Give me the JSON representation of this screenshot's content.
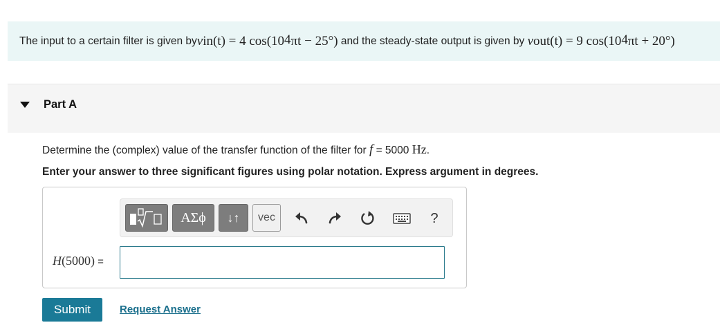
{
  "intro": {
    "text_before": "The input to a certain filter is given by ",
    "vin_symbol": "v",
    "vin_sub": "in",
    "vin_expr_a": "(t) = 4 cos(10",
    "vin_exp": "4",
    "vin_expr_b": "πt − 25°)",
    "text_middle": " and the steady-state output is given by ",
    "vout_symbol": "v",
    "vout_sub": "out",
    "vout_expr_a": "(t) = 9 cos(10",
    "vout_exp": "4",
    "vout_expr_b": "πt + 20°)"
  },
  "part": {
    "title": "Part A"
  },
  "question": {
    "text": "Determine the (complex) value of the transfer function of the filter for ",
    "var": "f",
    "equals": " = 5000 ",
    "unit": "Hz",
    "end": "."
  },
  "instruction": "Enter your answer to three significant figures using polar notation. Express argument in degrees.",
  "toolbar": {
    "greek_label": "ΑΣϕ",
    "arrows_label": "↓↑",
    "vec_label": "vec",
    "help_label": "?"
  },
  "answer": {
    "label_fn": "H",
    "label_arg": "(5000)",
    "label_eq": " =",
    "value": ""
  },
  "buttons": {
    "submit": "Submit",
    "request": "Request Answer"
  },
  "colors": {
    "intro_bg": "#eaf6f6",
    "primary": "#1a7a97",
    "link": "#1a6f8c"
  }
}
